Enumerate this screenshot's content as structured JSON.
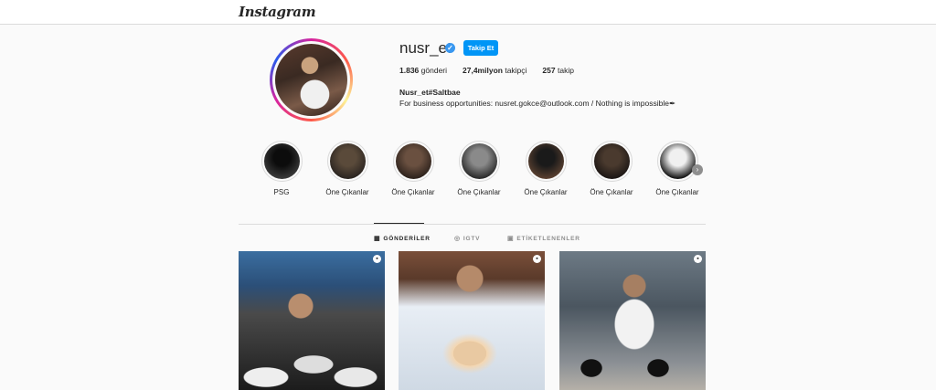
{
  "header": {
    "logo": "Instagram"
  },
  "profile": {
    "username": "nusr_et",
    "verified_icon": "verified-badge-icon",
    "follow_label": "Takip Et",
    "stats": [
      {
        "value": "1.836",
        "label": "gönderi"
      },
      {
        "value": "27,4milyon",
        "label": "takipçi"
      },
      {
        "value": "257",
        "label": "takip"
      }
    ],
    "full_name": "Nusr_et#Saltbae",
    "bio": "For business opportunities: nusret.gokce@outlook.com / Nothing is impossible✒"
  },
  "highlights": [
    {
      "label": "PSG",
      "colors": [
        "#0c0c0c",
        "#3a3a3a"
      ]
    },
    {
      "label": "Öne Çıkanlar",
      "colors": [
        "#5a4a3a",
        "#2a2420"
      ]
    },
    {
      "label": "Öne Çıkanlar",
      "colors": [
        "#6a5040",
        "#2d221c"
      ]
    },
    {
      "label": "Öne Çıkanlar",
      "colors": [
        "#8a8a8a",
        "#2a2a2a"
      ]
    },
    {
      "label": "Öne Çıkanlar",
      "colors": [
        "#1a1a1a",
        "#5a4030"
      ]
    },
    {
      "label": "Öne Çıkanlar",
      "colors": [
        "#4a3a2e",
        "#1c1614"
      ]
    },
    {
      "label": "Öne Çıkanlar",
      "colors": [
        "#f0f0f0",
        "#101010"
      ]
    }
  ],
  "tabs": [
    {
      "label": "GÖNDERİLER",
      "icon": "grid-icon",
      "glyph": "▦",
      "active": true
    },
    {
      "label": "IGTV",
      "icon": "igtv-icon",
      "glyph": "◎",
      "active": false
    },
    {
      "label": "ETİKETLENENLER",
      "icon": "tagged-icon",
      "glyph": "▣",
      "active": false
    }
  ],
  "posts": [
    {
      "type_icon": "carousel-icon"
    },
    {
      "type_icon": "carousel-icon"
    },
    {
      "type_icon": "carousel-icon"
    }
  ],
  "colors": {
    "follow_button": "#0095f6",
    "verified": "#3897f0"
  }
}
